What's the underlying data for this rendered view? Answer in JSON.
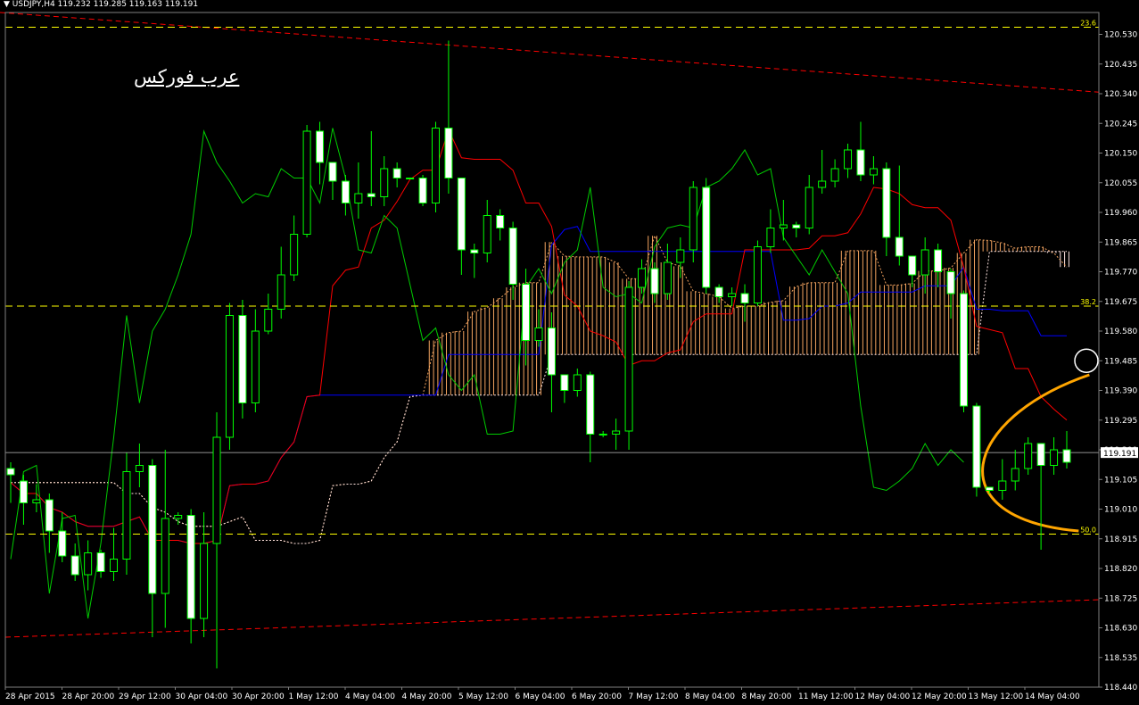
{
  "header": {
    "symbol_tf": "USDJPY,H4",
    "ohlc": "119.232 119.285 119.163 119.191"
  },
  "watermark": "عرب فوركس",
  "colors": {
    "bg": "#000000",
    "bull": "#000000",
    "bear": "#ffffff",
    "wick": "#00ff00",
    "tenkan": "#ff0000",
    "kijun": "#0000ff",
    "chikou": "#00cc00",
    "fib": "#ffff00",
    "trend": "#ff0000",
    "cloud_bear": "#ffe4e1",
    "cloud_bull": "#f4a460",
    "arrow": "#ffa500"
  },
  "chart_data": {
    "type": "candlestick",
    "title": "USDJPY,H4",
    "ylim": [
      118.44,
      120.6
    ],
    "y_ticks": [
      "120.530",
      "120.435",
      "120.340",
      "120.245",
      "120.150",
      "120.055",
      "119.960",
      "119.865",
      "119.770",
      "119.675",
      "119.580",
      "119.485",
      "119.390",
      "119.295",
      "119.200",
      "119.105",
      "119.010",
      "118.915",
      "118.820",
      "118.725",
      "118.630",
      "118.535",
      "118.440"
    ],
    "current_price": "119.191",
    "x_labels": [
      "28 Apr 2015",
      "28 Apr 20:00",
      "29 Apr 12:00",
      "30 Apr 04:00",
      "30 Apr 20:00",
      "1 May 12:00",
      "4 May 04:00",
      "4 May 20:00",
      "5 May 12:00",
      "6 May 04:00",
      "6 May 20:00",
      "7 May 12:00",
      "8 May 04:00",
      "8 May 20:00",
      "11 May 12:00",
      "12 May 04:00",
      "12 May 20:00",
      "13 May 12:00",
      "14 May 04:00"
    ],
    "fib_levels": [
      {
        "label": "23.6",
        "value": 120.553
      },
      {
        "label": "38.2",
        "value": 119.66
      },
      {
        "label": "50.0",
        "value": 118.93
      }
    ],
    "candles": [
      [
        119.14,
        119.12,
        119.16,
        119.03
      ],
      [
        119.1,
        119.03,
        119.12,
        118.96
      ],
      [
        119.03,
        119.04,
        119.09,
        119
      ],
      [
        119.04,
        118.94,
        119.06,
        118.87
      ],
      [
        118.94,
        118.86,
        119.0,
        118.84
      ],
      [
        118.86,
        118.8,
        118.9,
        118.78
      ],
      [
        118.8,
        118.87,
        118.91,
        118.75
      ],
      [
        118.87,
        118.81,
        118.88,
        118.79
      ],
      [
        118.81,
        118.85,
        118.95,
        118.78
      ],
      [
        118.85,
        119.13,
        119.19,
        118.8
      ],
      [
        119.13,
        119.15,
        119.22,
        119.08
      ],
      [
        119.15,
        118.74,
        119.17,
        118.6
      ],
      [
        118.74,
        118.98,
        119.2,
        118.63
      ],
      [
        118.98,
        118.99,
        119.0,
        118.96
      ],
      [
        118.99,
        118.66,
        119.01,
        118.58
      ],
      [
        118.66,
        118.9,
        119.0,
        118.6
      ],
      [
        118.9,
        119.24,
        119.32,
        118.5
      ],
      [
        119.24,
        119.63,
        119.67,
        119.2
      ],
      [
        119.63,
        119.35,
        119.68,
        119.3
      ],
      [
        119.35,
        119.58,
        119.65,
        119.32
      ],
      [
        119.58,
        119.65,
        119.7,
        119.57
      ],
      [
        119.65,
        119.76,
        119.85,
        119.62
      ],
      [
        119.76,
        119.89,
        119.95,
        119.74
      ],
      [
        119.89,
        120.22,
        120.24,
        119.88
      ],
      [
        120.22,
        120.12,
        120.25,
        120.05
      ],
      [
        120.12,
        120.06,
        120.12,
        120.0
      ],
      [
        120.06,
        119.99,
        120.08,
        119.95
      ],
      [
        119.99,
        120.02,
        120.12,
        119.94
      ],
      [
        120.02,
        120.01,
        120.22,
        119.98
      ],
      [
        120.01,
        120.1,
        120.14,
        119.98
      ],
      [
        120.1,
        120.07,
        120.12,
        120.04
      ],
      [
        120.07,
        120.07,
        120.07,
        120.07
      ],
      [
        120.07,
        119.99,
        120.08,
        119.98
      ],
      [
        119.99,
        120.23,
        120.25,
        119.96
      ],
      [
        120.23,
        120.07,
        120.51,
        120.02
      ],
      [
        120.07,
        119.84,
        120.07,
        119.76
      ],
      [
        119.84,
        119.83,
        119.86,
        119.75
      ],
      [
        119.83,
        119.95,
        120.0,
        119.8
      ],
      [
        119.95,
        119.91,
        119.97,
        119.87
      ],
      [
        119.91,
        119.73,
        119.93,
        119.68
      ],
      [
        119.73,
        119.55,
        119.78,
        119.47
      ],
      [
        119.55,
        119.59,
        119.65,
        119.53
      ],
      [
        119.59,
        119.44,
        119.64,
        119.32
      ],
      [
        119.44,
        119.39,
        119.44,
        119.35
      ],
      [
        119.39,
        119.44,
        119.46,
        119.37
      ],
      [
        119.44,
        119.25,
        119.45,
        119.16
      ],
      [
        119.25,
        119.25,
        119.26,
        119.24
      ],
      [
        119.25,
        119.26,
        119.3,
        119.2
      ],
      [
        119.26,
        119.72,
        119.74,
        119.2
      ],
      [
        119.72,
        119.78,
        119.81,
        119.7
      ],
      [
        119.78,
        119.7,
        119.8,
        119.67
      ],
      [
        119.7,
        119.8,
        119.86,
        119.68
      ],
      [
        119.8,
        119.84,
        119.88,
        119.75
      ],
      [
        119.84,
        120.04,
        120.06,
        119.8
      ],
      [
        120.04,
        119.72,
        120.07,
        119.7
      ],
      [
        119.72,
        119.69,
        119.73,
        119.67
      ],
      [
        119.69,
        119.7,
        119.72,
        119.66
      ],
      [
        119.7,
        119.67,
        119.73,
        119.61
      ],
      [
        119.67,
        119.85,
        119.87,
        119.66
      ],
      [
        119.85,
        119.91,
        119.97,
        119.83
      ],
      [
        119.91,
        119.92,
        120.0,
        119.87
      ],
      [
        119.92,
        119.91,
        119.93,
        119.88
      ],
      [
        119.91,
        120.04,
        120.08,
        119.89
      ],
      [
        120.04,
        120.06,
        120.16,
        120.02
      ],
      [
        120.06,
        120.1,
        120.13,
        120.04
      ],
      [
        120.1,
        120.16,
        120.18,
        120.07
      ],
      [
        120.16,
        120.08,
        120.25,
        120.06
      ],
      [
        120.08,
        120.1,
        120.14,
        120.05
      ],
      [
        120.1,
        119.88,
        120.12,
        119.82
      ],
      [
        119.88,
        119.82,
        120.11,
        119.79
      ],
      [
        119.82,
        119.76,
        119.82,
        119.72
      ],
      [
        119.76,
        119.84,
        119.88,
        119.7
      ],
      [
        119.84,
        119.77,
        119.86,
        119.72
      ],
      [
        119.77,
        119.7,
        119.78,
        119.62
      ],
      [
        119.7,
        119.34,
        119.71,
        119.32
      ],
      [
        119.34,
        119.08,
        119.35,
        119.05
      ],
      [
        119.08,
        119.07,
        119.08,
        119.06
      ],
      [
        119.07,
        119.1,
        119.17,
        119.04
      ],
      [
        119.1,
        119.14,
        119.2,
        119.07
      ],
      [
        119.14,
        119.22,
        119.24,
        119.12
      ],
      [
        119.22,
        119.15,
        119.22,
        118.88
      ],
      [
        119.15,
        119.2,
        119.24,
        119.12
      ],
      [
        119.2,
        119.16,
        119.26,
        119.14
      ]
    ]
  }
}
